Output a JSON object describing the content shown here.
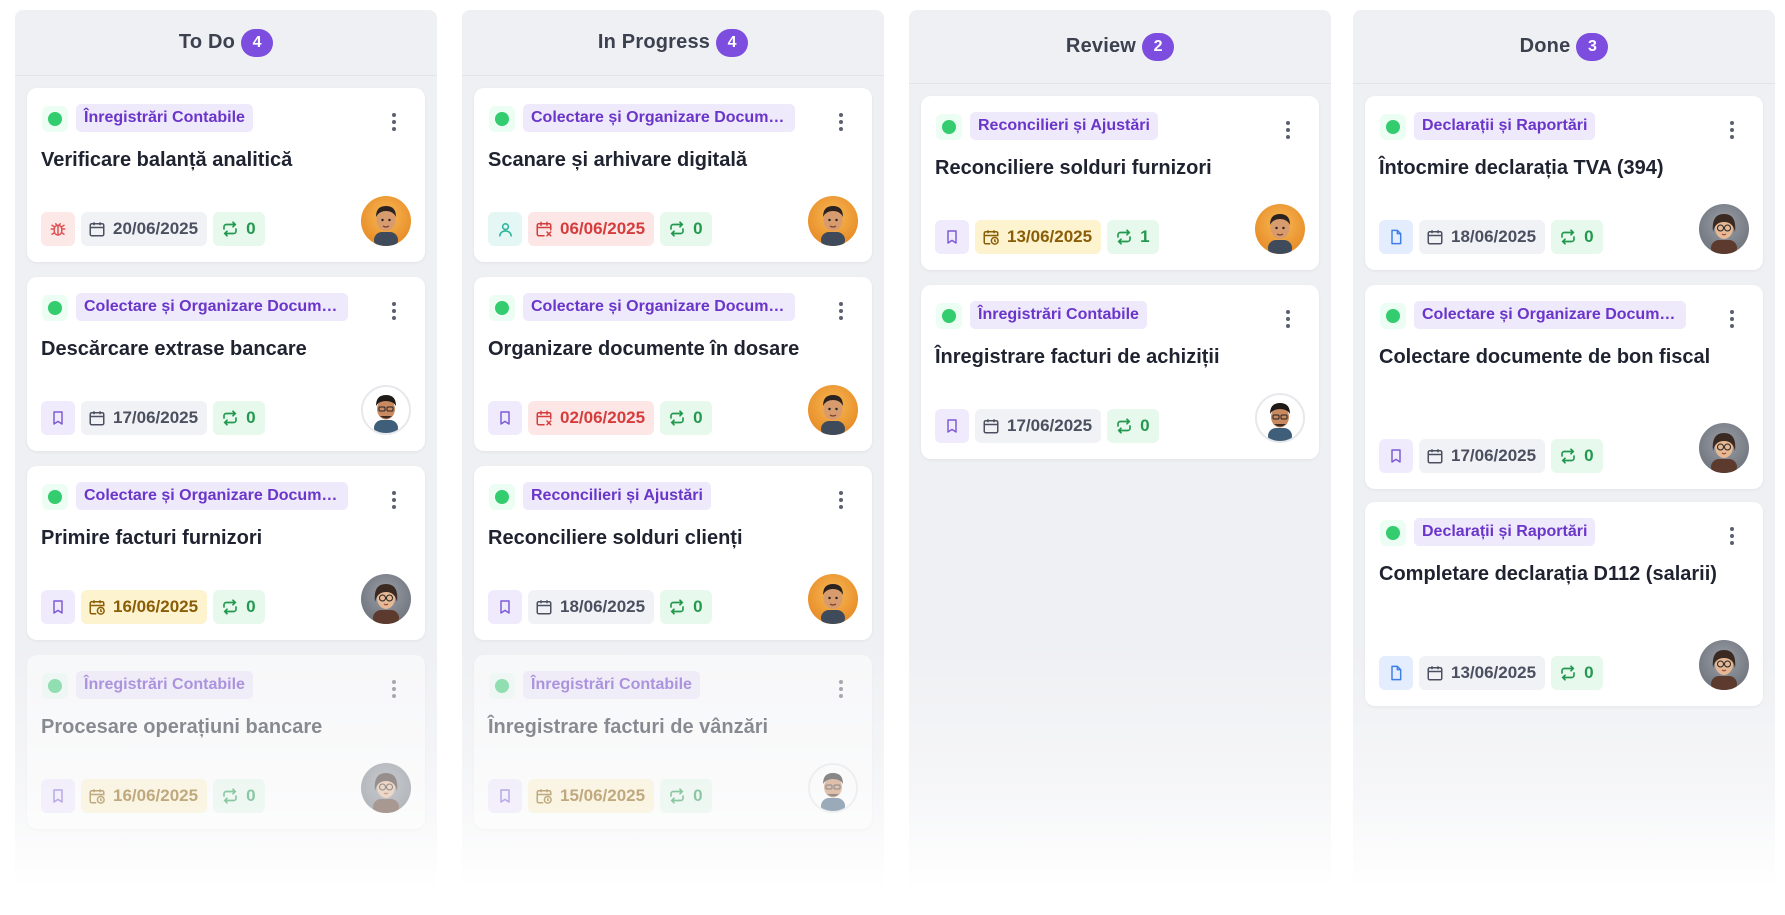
{
  "colors": {
    "accent": "#7c4ddf",
    "status_green": "#33cc6e",
    "category_text": "#6a36c9"
  },
  "columns": [
    {
      "title": "To Do",
      "count": "4",
      "cards": [
        {
          "category": "Înregistrări Contabile",
          "title": "Verificare balanță analitică",
          "type_icon": "bug-icon",
          "date": "20/06/2025",
          "date_status": "normal",
          "repeat": "0",
          "avatar": "orange"
        },
        {
          "category": "Colectare și Organizare Documente",
          "title": "Descărcare extrase bancare",
          "type_icon": "bookmark-icon",
          "date": "17/06/2025",
          "date_status": "normal",
          "repeat": "0",
          "avatar": "white"
        },
        {
          "category": "Colectare și Organizare Documente",
          "title": "Primire facturi furnizori",
          "type_icon": "bookmark-icon",
          "date": "16/06/2025",
          "date_status": "soon",
          "repeat": "0",
          "avatar": "gray"
        },
        {
          "category": "Înregistrări Contabile",
          "title": "Procesare operațiuni bancare",
          "type_icon": "bookmark-icon",
          "date": "16/06/2025",
          "date_status": "soon",
          "repeat": "0",
          "avatar": "gray"
        }
      ]
    },
    {
      "title": "In Progress",
      "count": "4",
      "cards": [
        {
          "category": "Colectare și Organizare Documente",
          "title": "Scanare și arhivare digitală",
          "type_icon": "user-icon",
          "date": "06/06/2025",
          "date_status": "overdue",
          "repeat": "0",
          "avatar": "orange"
        },
        {
          "category": "Colectare și Organizare Documente",
          "title": "Organizare documente în dosare",
          "type_icon": "bookmark-icon",
          "date": "02/06/2025",
          "date_status": "overdue",
          "repeat": "0",
          "avatar": "orange"
        },
        {
          "category": "Reconcilieri și Ajustări",
          "title": "Reconciliere solduri clienți",
          "type_icon": "bookmark-icon",
          "date": "18/06/2025",
          "date_status": "normal",
          "repeat": "0",
          "avatar": "orange"
        },
        {
          "category": "Înregistrări Contabile",
          "title": "Înregistrare facturi de vânzări",
          "type_icon": "bookmark-icon",
          "date": "15/06/2025",
          "date_status": "soon",
          "repeat": "0",
          "avatar": "white"
        }
      ]
    },
    {
      "title": "Review",
      "count": "2",
      "cards": [
        {
          "category": "Reconcilieri și Ajustări",
          "title": "Reconciliere solduri furnizori",
          "type_icon": "bookmark-icon",
          "date": "13/06/2025",
          "date_status": "soon",
          "repeat": "1",
          "avatar": "orange"
        },
        {
          "category": "Înregistrări Contabile",
          "title": "Înregistrare facturi de achiziții",
          "type_icon": "bookmark-icon",
          "date": "17/06/2025",
          "date_status": "normal",
          "repeat": "0",
          "avatar": "white"
        }
      ]
    },
    {
      "title": "Done",
      "count": "3",
      "cards": [
        {
          "category": "Declarații și Raportări",
          "title": "Întocmire declarația TVA (394)",
          "type_icon": "doc-icon",
          "date": "18/06/2025",
          "date_status": "normal",
          "repeat": "0",
          "avatar": "gray"
        },
        {
          "category": "Colectare și Organizare Documente",
          "title": "Colectare documente de bon fiscal",
          "type_icon": "bookmark-icon",
          "date": "17/06/2025",
          "date_status": "normal",
          "repeat": "0",
          "avatar": "gray"
        },
        {
          "category": "Declarații și Raportări",
          "title": "Completare declarația D112 (salarii)",
          "type_icon": "doc-icon",
          "date": "13/06/2025",
          "date_status": "normal",
          "repeat": "0",
          "avatar": "gray"
        }
      ]
    }
  ]
}
